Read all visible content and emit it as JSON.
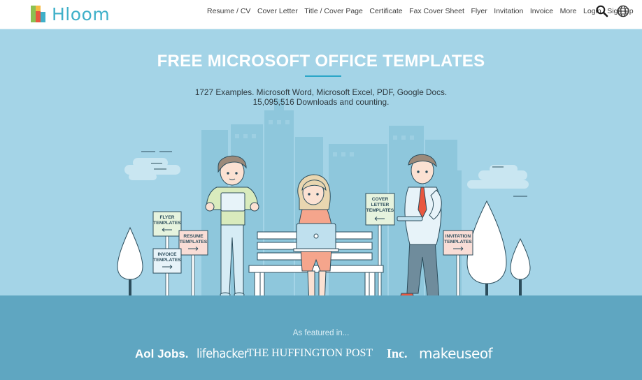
{
  "brand": {
    "name": "Hloom"
  },
  "nav": {
    "items": [
      "Resume / CV",
      "Cover Letter",
      "Title / Cover Page",
      "Certificate",
      "Fax Cover Sheet",
      "Flyer",
      "Invitation",
      "Invoice",
      "More",
      "Login | Sign Up"
    ],
    "icons": [
      "search-icon",
      "globe-icon"
    ]
  },
  "hero": {
    "title": "FREE MICROSOFT OFFICE TEMPLATES",
    "subtitle_line1": "1727 Examples. Microsoft Word, Microsoft Excel, PDF, Google Docs.",
    "subtitle_line2": "15,095,516 Downloads and counting.",
    "signs": {
      "flyer": [
        "FLYER",
        "TEMPLATES"
      ],
      "resume": [
        "RESUME",
        "TEMPLATES"
      ],
      "invoice": [
        "INVOICE",
        "TEMPLATES"
      ],
      "cover_letter": [
        "COVER",
        "LETTER",
        "TEMPLATES"
      ],
      "invitation": [
        "INVITATION",
        "TEMPLATES"
      ]
    }
  },
  "featured": {
    "label": "As featured in...",
    "logos": [
      "Aol Jobs.",
      "lifehacker",
      "THE HUFFINGTON POST",
      "Inc.",
      "makeuseof"
    ]
  },
  "colors": {
    "sky": "#a4d4e7",
    "ground": "#5fa6c1",
    "accent": "#2aa6c8",
    "logo_text": "#3fb0c9"
  }
}
